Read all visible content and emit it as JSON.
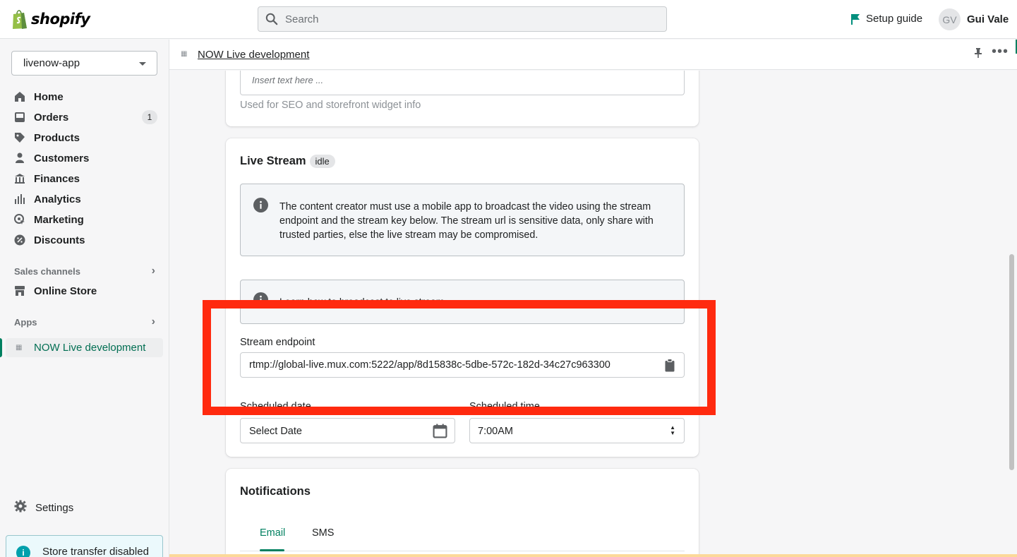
{
  "topbar": {
    "logo_text": "shopify",
    "search_placeholder": "Search",
    "setup_guide": "Setup guide",
    "avatar_initials": "GV",
    "user_name": "Gui Vale"
  },
  "sidebar": {
    "store_name": "livenow-app",
    "nav": [
      {
        "label": "Home",
        "icon": "home-icon"
      },
      {
        "label": "Orders",
        "icon": "inbox-icon",
        "badge": "1"
      },
      {
        "label": "Products",
        "icon": "tag-icon"
      },
      {
        "label": "Customers",
        "icon": "person-icon"
      },
      {
        "label": "Finances",
        "icon": "bank-icon"
      },
      {
        "label": "Analytics",
        "icon": "bar-chart-icon"
      },
      {
        "label": "Marketing",
        "icon": "target-icon"
      },
      {
        "label": "Discounts",
        "icon": "discount-icon"
      }
    ],
    "sales_channels_label": "Sales channels",
    "online_store": "Online Store",
    "apps_label": "Apps",
    "active_app": "NOW Live development",
    "settings": "Settings",
    "store_transfer": "Store transfer disabled"
  },
  "app_header": {
    "title": "NOW Live development"
  },
  "seo_card": {
    "placeholder": "Insert text here ...",
    "help_text": "Used for SEO and storefront widget info"
  },
  "live_stream": {
    "title": "Live Stream",
    "status": "idle",
    "info_banner": "The content creator must use a mobile app to broadcast the video using the stream endpoint and the stream key below. The stream url is sensitive data, only share with trusted parties, else the live stream may be compromised.",
    "second_banner": "Learn how to broadcast to live stream",
    "endpoint_label": "Stream endpoint",
    "endpoint_value": "rtmp://global-live.mux.com:5222/app/8d15838c-5dbe-572c-182d-34c27c963300",
    "scheduled_date_label": "Scheduled date",
    "scheduled_time_label": "Scheduled time",
    "date_value": "Select Date",
    "time_value": "7:00AM"
  },
  "notifications": {
    "title": "Notifications",
    "tabs": [
      {
        "label": "Email",
        "active": true
      },
      {
        "label": "SMS",
        "active": false
      }
    ]
  },
  "colors": {
    "brand_green": "#008060",
    "highlight_red": "#ff2a0f"
  }
}
